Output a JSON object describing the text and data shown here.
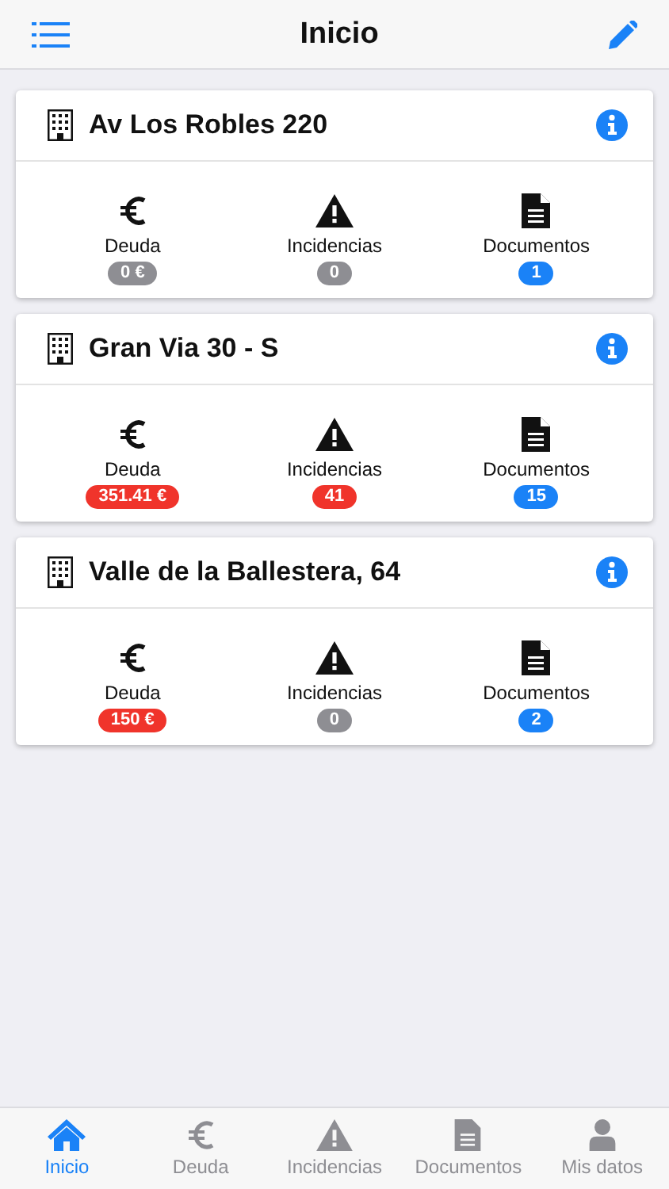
{
  "header": {
    "title": "Inicio"
  },
  "properties": [
    {
      "name": "Av Los Robles 220",
      "stats": [
        {
          "kind": "euro",
          "label": "Deuda",
          "count": "0 €",
          "color": "#8e8e93"
        },
        {
          "kind": "warning",
          "label": "Incidencias",
          "count": "0",
          "color": "#8e8e93"
        },
        {
          "kind": "document",
          "label": "Documentos",
          "count": "1",
          "color": "#1a82f7"
        }
      ]
    },
    {
      "name": "Gran Via 30 - S",
      "stats": [
        {
          "kind": "euro",
          "label": "Deuda",
          "count": "351.41 €",
          "color": "#f0342b"
        },
        {
          "kind": "warning",
          "label": "Incidencias",
          "count": "41",
          "color": "#f0342b"
        },
        {
          "kind": "document",
          "label": "Documentos",
          "count": "15",
          "color": "#1a82f7"
        }
      ]
    },
    {
      "name": "Valle de la Ballestera, 64",
      "stats": [
        {
          "kind": "euro",
          "label": "Deuda",
          "count": "150 €",
          "color": "#f0342b"
        },
        {
          "kind": "warning",
          "label": "Incidencias",
          "count": "0",
          "color": "#8e8e93"
        },
        {
          "kind": "document",
          "label": "Documentos",
          "count": "2",
          "color": "#1a82f7"
        }
      ]
    }
  ],
  "tabs": [
    {
      "kind": "home",
      "label": "Inicio",
      "selected": true
    },
    {
      "kind": "euro",
      "label": "Deuda",
      "selected": false
    },
    {
      "kind": "warning",
      "label": "Incidencias",
      "selected": false
    },
    {
      "kind": "document",
      "label": "Documentos",
      "selected": false
    },
    {
      "kind": "person",
      "label": "Mis datos",
      "selected": false
    }
  ]
}
